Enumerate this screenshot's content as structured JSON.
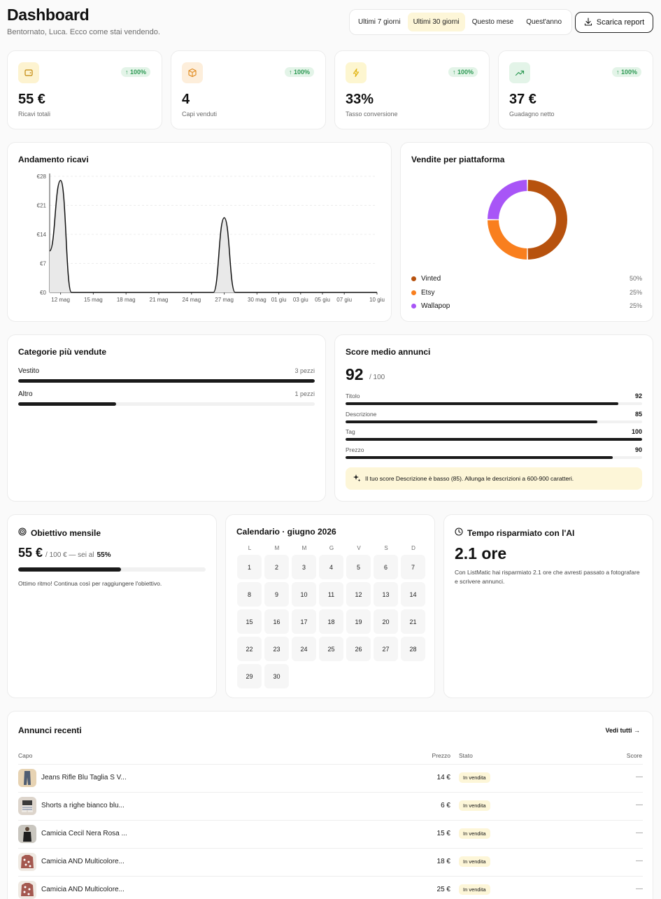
{
  "header": {
    "title": "Dashboard",
    "subtitle": "Bentornato, Luca. Ecco come stai vendendo.",
    "ranges": [
      "Ultimi 7 giorni",
      "Ultimi 30 giorni",
      "Questo mese",
      "Quest'anno"
    ],
    "active_range": "Ultimi 30 giorni",
    "report_label": "Scarica report"
  },
  "stats": [
    {
      "icon": "wallet-icon",
      "badge": "↑ 100%",
      "value": "55 €",
      "label": "Ricavi totali",
      "color": "#fdf3d0"
    },
    {
      "icon": "box-icon",
      "badge": "↑ 100%",
      "value": "4",
      "label": "Capi venduti",
      "color": "#fdeedb"
    },
    {
      "icon": "lightning-icon",
      "badge": "↑ 100%",
      "value": "33%",
      "label": "Tasso conversione",
      "color": "#fdf6d0"
    },
    {
      "icon": "trend-up-icon",
      "badge": "↑ 100%",
      "value": "37 €",
      "label": "Guadagno netto",
      "color": "#e3f4e8"
    }
  ],
  "revenue": {
    "title": "Andamento ricavi"
  },
  "chart_data": {
    "type": "area",
    "title": "Andamento ricavi",
    "x_ticks": [
      "12 mag",
      "15 mag",
      "18 mag",
      "21 mag",
      "24 mag",
      "27 mag",
      "30 mag",
      "01 giu",
      "03 giu",
      "05 giu",
      "07 giu",
      "10 giu"
    ],
    "y_ticks": [
      "€0",
      "€7",
      "€14",
      "€21",
      "€28"
    ],
    "ylim": [
      0,
      28
    ],
    "points": [
      {
        "x": "11 mag",
        "y": 10
      },
      {
        "x": "12 mag",
        "y": 27
      },
      {
        "x": "13 mag",
        "y": 0
      },
      {
        "x": "26 mag",
        "y": 0
      },
      {
        "x": "27 mag",
        "y": 18
      },
      {
        "x": "28 mag",
        "y": 0
      },
      {
        "x": "10 giu",
        "y": 0
      }
    ],
    "grid": true
  },
  "platforms": {
    "title": "Vendite per piattaforma",
    "items": [
      {
        "name": "Vinted",
        "pct": "50%",
        "value": 50,
        "color": "#b7520e"
      },
      {
        "name": "Etsy",
        "pct": "25%",
        "value": 25,
        "color": "#f97f1e"
      },
      {
        "name": "Wallapop",
        "pct": "25%",
        "value": 25,
        "color": "#a855f7"
      }
    ]
  },
  "categories": {
    "title": "Categorie più vendute",
    "items": [
      {
        "name": "Vestito",
        "count": "3 pezzi",
        "fraction": 1.0
      },
      {
        "name": "Altro",
        "count": "1 pezzi",
        "fraction": 0.33
      }
    ]
  },
  "score": {
    "title": "Score medio annunci",
    "value": "92",
    "max": "/ 100",
    "items": [
      {
        "name": "Titolo",
        "value": "92",
        "fraction": 0.92
      },
      {
        "name": "Descrizione",
        "value": "85",
        "fraction": 0.85
      },
      {
        "name": "Tag",
        "value": "100",
        "fraction": 1.0
      },
      {
        "name": "Prezzo",
        "value": "90",
        "fraction": 0.9
      }
    ],
    "tip": "Il tuo score Descrizione è basso (85). Allunga le descrizioni a 600-900 caratteri."
  },
  "goal": {
    "title": "Obiettivo mensile",
    "value": "55 €",
    "detail_a": "/ 100 € — sei al",
    "detail_b": "55%",
    "fraction": 0.55,
    "message": "Ottimo ritmo! Continua così per raggiungere l'obiettivo."
  },
  "calendar": {
    "title": "Calendario · giugno 2026",
    "weekdays": [
      "L",
      "M",
      "M",
      "G",
      "V",
      "S",
      "D"
    ],
    "days": [
      "1",
      "2",
      "3",
      "4",
      "5",
      "6",
      "7",
      "8",
      "9",
      "10",
      "11",
      "12",
      "13",
      "14",
      "15",
      "16",
      "17",
      "18",
      "19",
      "20",
      "21",
      "22",
      "23",
      "24",
      "25",
      "26",
      "27",
      "28",
      "29",
      "30"
    ]
  },
  "time_saved": {
    "title": "Tempo risparmiato con l'AI",
    "value": "2.1 ore",
    "description": "Con ListMatic hai risparmiato 2.1 ore che avresti passato a fotografare e scrivere annunci."
  },
  "recent": {
    "title": "Annunci recenti",
    "see_all": "Vedi tutti →",
    "columns": [
      "Capo",
      "Prezzo",
      "Stato",
      "Score"
    ],
    "rows": [
      {
        "name": "Jeans Rifle Blu Taglia S V...",
        "price": "14 €",
        "status": "In vendita",
        "score": "—"
      },
      {
        "name": "Shorts a righe bianco blu...",
        "price": "6 €",
        "status": "In vendita",
        "score": "—"
      },
      {
        "name": "Camicia Cecil Nera Rosa ...",
        "price": "15 €",
        "status": "In vendita",
        "score": "—"
      },
      {
        "name": "Camicia AND Multicolore...",
        "price": "18 €",
        "status": "In vendita",
        "score": "—"
      },
      {
        "name": "Camicia AND Multicolore...",
        "price": "25 €",
        "status": "In vendita",
        "score": "—"
      }
    ]
  }
}
